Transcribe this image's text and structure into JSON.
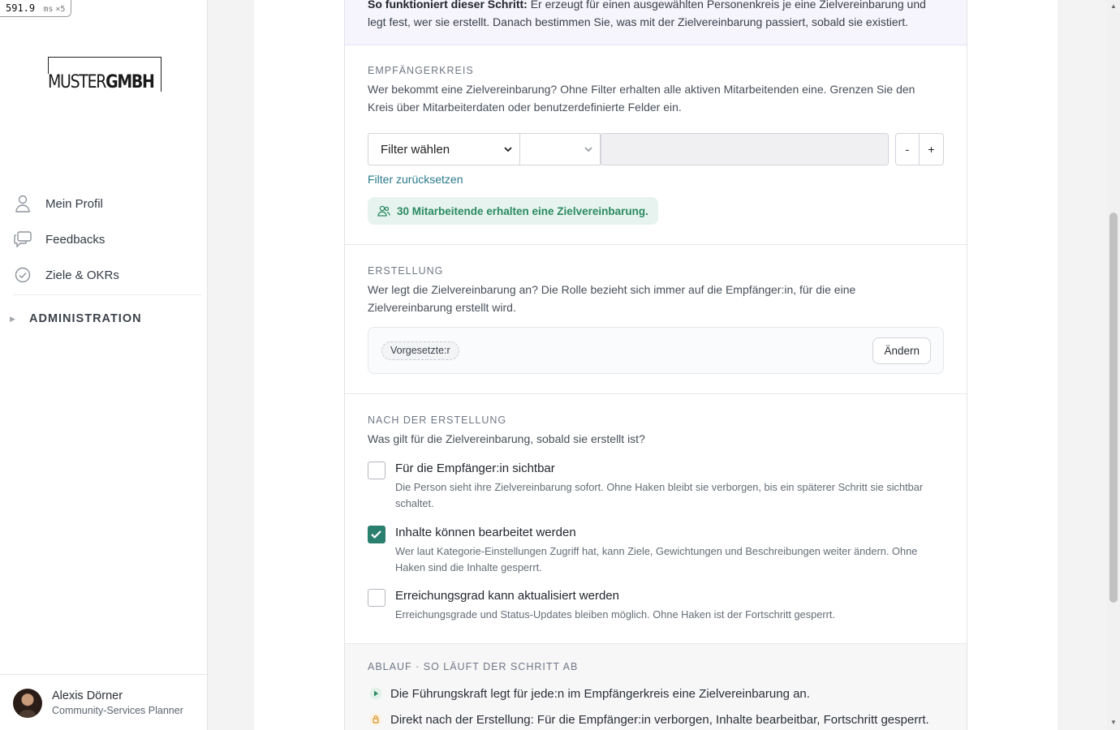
{
  "perf": {
    "value": "591.9",
    "unit": "ms",
    "mult": "×5"
  },
  "brand": {
    "logo_light": "MUSTER",
    "logo_bold": "GMBH"
  },
  "sidebar": {
    "items": [
      {
        "label": "Mein Profil",
        "icon": "person-icon"
      },
      {
        "label": "Feedbacks",
        "icon": "chat-icon"
      },
      {
        "label": "Ziele & OKRs",
        "icon": "check-circle-icon"
      }
    ],
    "admin_label": "ADMINISTRATION"
  },
  "user": {
    "name": "Alexis Dörner",
    "role": "Community-Services Planner"
  },
  "intro": {
    "bold": "So funktioniert dieser Schritt:",
    "text": " Er erzeugt für einen ausgewählten Personenkreis je eine Zielvereinbarung und legt fest, wer sie erstellt. Danach bestimmen Sie, was mit der Zielvereinbarung passiert, sobald sie existiert."
  },
  "recipients": {
    "title": "EMPFÄNGERKREIS",
    "description": "Wer bekommt eine Zielvereinbarung? Ohne Filter erhalten alle aktiven Mitarbeitenden eine. Grenzen Sie den Kreis über Mitarbeiterdaten oder benutzerdefinierte Felder ein.",
    "filter_select": "Filter wählen",
    "operator_select": "",
    "value_input": "",
    "minus": "-",
    "plus": "+",
    "reset_link": "Filter zurücksetzen",
    "count_text": "30 Mitarbeitende erhalten eine Zielvereinbarung."
  },
  "creation": {
    "title": "ERSTELLUNG",
    "description": "Wer legt die Zielvereinbarung an? Die Rolle bezieht sich immer auf die Empfänger:in, für die eine Zielvereinbarung erstellt wird.",
    "role_tag": "Vorgesetzte:r",
    "change_button": "Ändern"
  },
  "after": {
    "title": "NACH DER ERSTELLUNG",
    "description": "Was gilt für die Zielvereinbarung, sobald sie erstellt ist?",
    "options": [
      {
        "label": "Für die Empfänger:in sichtbar",
        "desc": "Die Person sieht ihre Zielvereinbarung sofort. Ohne Haken bleibt sie verborgen, bis ein späterer Schritt sie sichtbar schaltet.",
        "checked": false
      },
      {
        "label": "Inhalte können bearbeitet werden",
        "desc": "Wer laut Kategorie-Einstellungen Zugriff hat, kann Ziele, Gewichtungen und Beschreibungen weiter ändern. Ohne Haken sind die Inhalte gesperrt.",
        "checked": true
      },
      {
        "label": "Erreichungsgrad kann aktualisiert werden",
        "desc": "Erreichungsgrade und Status-Updates bleiben möglich. Ohne Haken ist der Fortschritt gesperrt.",
        "checked": false
      }
    ]
  },
  "flow": {
    "title": "ABLAUF · SO LÄUFT DER SCHRITT AB",
    "steps": [
      {
        "text": "Die Führungskraft legt für jede:n im Empfängerkreis eine Zielvereinbarung an.",
        "icon": "play-icon"
      },
      {
        "text": "Direkt nach der Erstellung: Für die Empfänger:in verborgen, Inhalte bearbeitbar, Fortschritt gesperrt.",
        "icon": "lock-icon"
      }
    ]
  },
  "colors": {
    "accent": "#2b7f6e",
    "link": "#2a7a8c",
    "success_bg": "#e7f3ee",
    "success_text": "#2a8a63",
    "intro_bg": "#f6f4fd"
  }
}
